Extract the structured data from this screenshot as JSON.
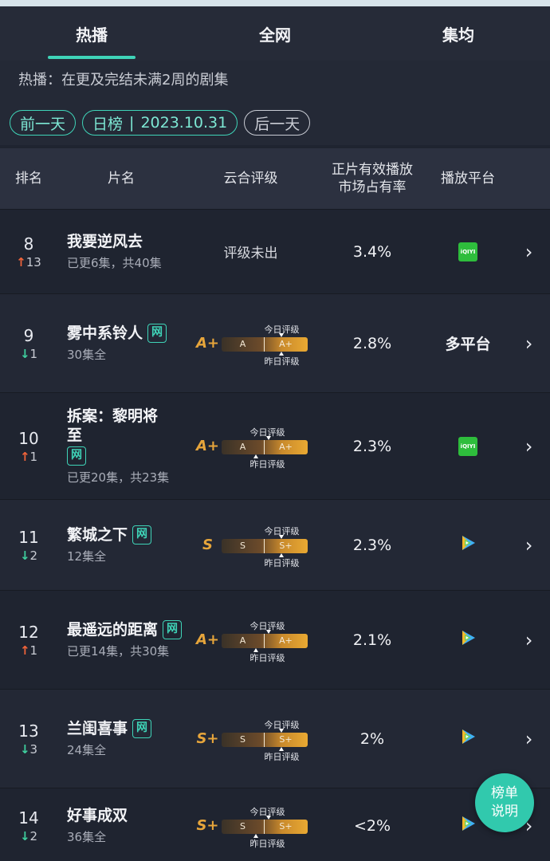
{
  "tabs": [
    {
      "label": "热播",
      "active": true
    },
    {
      "label": "全网",
      "active": false
    },
    {
      "label": "集均",
      "active": false
    }
  ],
  "subtitle": "热播：在更及完结未满2周的剧集",
  "date_nav": {
    "prev": "前一天",
    "board": "日榜",
    "sep": "|",
    "date": "2023.10.31",
    "next": "后一天"
  },
  "table_header": {
    "rank": "排名",
    "name": "片名",
    "grade": "云合评级",
    "share_line1": "正片有效播放",
    "share_line2": "市场占有率",
    "platform": "播放平台"
  },
  "grade_labels": {
    "today": "今日评级",
    "yesterday": "昨日评级"
  },
  "rows": [
    {
      "rank": "8",
      "change_dir": "up",
      "change_arrow": "↑",
      "change": "13",
      "title": "我要逆风去",
      "wang": "",
      "meta": "已更6集，共40集",
      "grade_none": "评级未出",
      "share": "3.4%",
      "platform": "iqiyi",
      "platform_label": "iQIYI"
    },
    {
      "rank": "9",
      "change_dir": "down",
      "change_arrow": "↓",
      "change": "1",
      "title": "雾中系铃人",
      "wang": "网",
      "meta": "30集全",
      "grade": "A+",
      "scale_left": "A",
      "scale_right": "A+",
      "share": "2.8%",
      "platform": "multi",
      "platform_label": "多平台"
    },
    {
      "rank": "10",
      "change_dir": "up",
      "change_arrow": "↑",
      "change": "1",
      "title_line1": "拆案：黎明将",
      "title_line2": "至",
      "wang": "网",
      "meta": "已更20集，共23集",
      "grade": "A+",
      "scale_left": "A",
      "scale_right": "A+",
      "share": "2.3%",
      "platform": "iqiyi",
      "platform_label": "iQIYI"
    },
    {
      "rank": "11",
      "change_dir": "down",
      "change_arrow": "↓",
      "change": "2",
      "title": "繁城之下",
      "wang": "网",
      "meta": "12集全",
      "grade": "S",
      "scale_left": "S",
      "scale_right": "S+",
      "share": "2.3%",
      "platform": "tencent",
      "platform_label": ""
    },
    {
      "rank": "12",
      "change_dir": "up",
      "change_arrow": "↑",
      "change": "1",
      "title": "最遥远的距离",
      "wang": "网",
      "meta": "已更14集，共30集",
      "grade": "A+",
      "scale_left": "A",
      "scale_right": "A+",
      "share": "2.1%",
      "platform": "tencent",
      "platform_label": ""
    },
    {
      "rank": "13",
      "change_dir": "down",
      "change_arrow": "↓",
      "change": "3",
      "title": "兰闺喜事",
      "wang": "网",
      "meta": "24集全",
      "grade": "S+",
      "scale_left": "S",
      "scale_right": "S+",
      "share": "2%",
      "platform": "tencent",
      "platform_label": ""
    },
    {
      "rank": "14",
      "change_dir": "down",
      "change_arrow": "↓",
      "change": "2",
      "title": "好事成双",
      "wang": "",
      "meta": "36集全",
      "grade": "S+",
      "scale_left": "S",
      "scale_right": "S+",
      "share": "<2%",
      "platform": "tencent",
      "platform_label": ""
    }
  ],
  "row_arrow": "›",
  "float_button": {
    "line1": "榜单",
    "line2": "说明"
  },
  "colors": {
    "accent": "#3fd4b8",
    "up": "#f0643a",
    "down": "#3fcf9e",
    "grade": "#e6a53b",
    "iqiyi": "#2ebd3c"
  }
}
